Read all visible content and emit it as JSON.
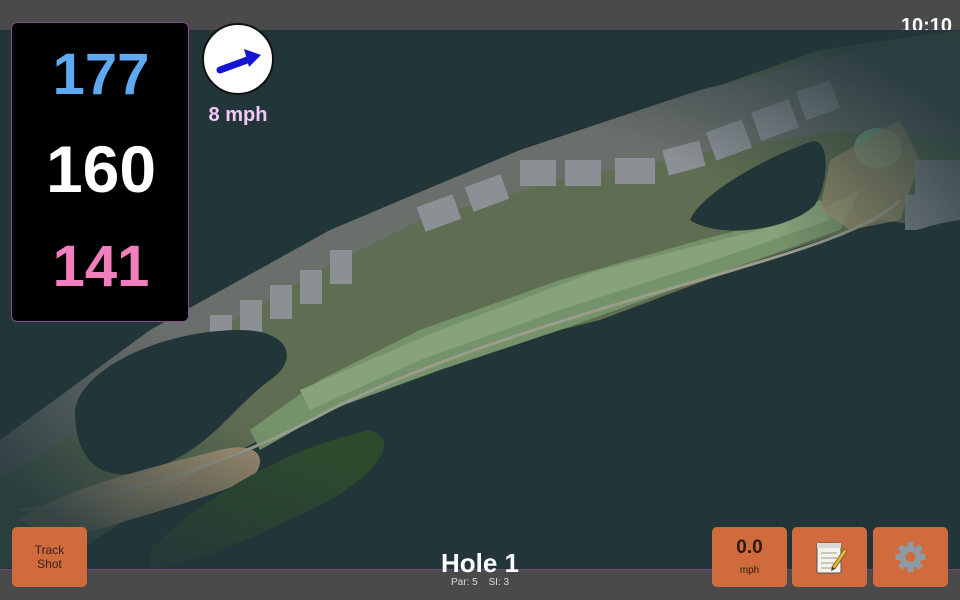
{
  "status_bar": {
    "time": "10:10"
  },
  "distances": {
    "back": "177",
    "middle": "160",
    "front": "141"
  },
  "wind": {
    "speed_label": "8 mph",
    "direction_icon": "wind-arrow-icon"
  },
  "hole": {
    "title": "Hole 1",
    "par_label": "Par: 5",
    "si_label": "SI: 3"
  },
  "buttons": {
    "track_shot_line1": "Track",
    "track_shot_line2": "Shot",
    "speed_value": "0.0",
    "speed_unit": "mph",
    "notes_icon": "notepad-icon",
    "settings_icon": "gear-icon"
  },
  "colors": {
    "back_distance": "#5fa9f2",
    "middle_distance": "#ffffff",
    "front_distance": "#f27fbd",
    "button": "#cf6b3c",
    "accent_border": "#7a3f7f"
  }
}
